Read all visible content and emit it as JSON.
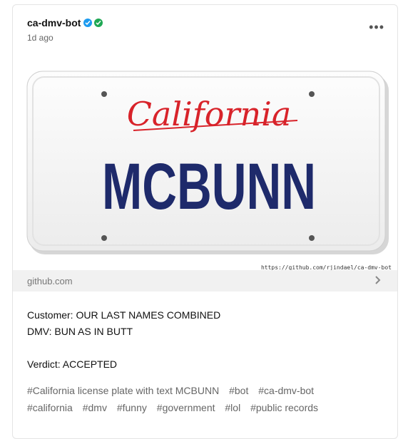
{
  "post": {
    "username": "ca-dmv-bot",
    "timestamp": "1d ago",
    "more_label": "•••",
    "plate": {
      "state": "California",
      "text": "MCBUNN",
      "source_url": "https://github.com/rjindael/ca-dmv-bot"
    },
    "link": {
      "domain": "github.com",
      "icon": "chevron-right-icon"
    },
    "customer_line": "Customer: OUR LAST NAMES COMBINED",
    "dmv_line": "DMV: BUN AS IN BUTT",
    "verdict_line": "Verdict: ACCEPTED",
    "tags": [
      "#California license plate with text MCBUNN",
      "#bot",
      "#ca-dmv-bot",
      "#california",
      "#dmv",
      "#funny",
      "#government",
      "#lol",
      "#public records"
    ]
  },
  "colors": {
    "state_red": "#d8232a",
    "plate_blue": "#1e2a6b",
    "verified_blue": "#1d9bf0",
    "verified_green": "#1fa854"
  }
}
